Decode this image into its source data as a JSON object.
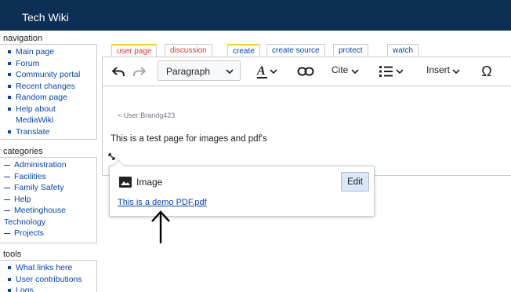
{
  "header": {
    "title": "Tech Wiki"
  },
  "sidebar": {
    "navigation": {
      "heading": "navigation",
      "items": [
        "Main page",
        "Forum",
        "Community portal",
        "Recent changes",
        "Random page",
        "Help about",
        "MediaWiki",
        "Translate"
      ]
    },
    "categories": {
      "heading": "categories",
      "items": [
        "Administration",
        "Facilities",
        "Family Safety",
        "Help",
        "Meetinghouse",
        "Technology",
        "Projects"
      ]
    },
    "tools": {
      "heading": "tools",
      "items": [
        "What links here",
        "User contributions",
        "Logs"
      ]
    }
  },
  "tabs": {
    "user_page": "user page",
    "discussion": "discussion",
    "create": "create",
    "create_source": "create source",
    "protect": "protect",
    "watch": "watch"
  },
  "toolbar": {
    "paragraph": "Paragraph",
    "cite": "Cite",
    "insert": "Insert",
    "special_char": "Ω"
  },
  "content": {
    "breadcrumb": "< User:Brandg423",
    "text": "This is a test page for images and pdf's"
  },
  "popup": {
    "label": "Image",
    "edit": "Edit",
    "link": "This is a demo PDF.pdf"
  }
}
